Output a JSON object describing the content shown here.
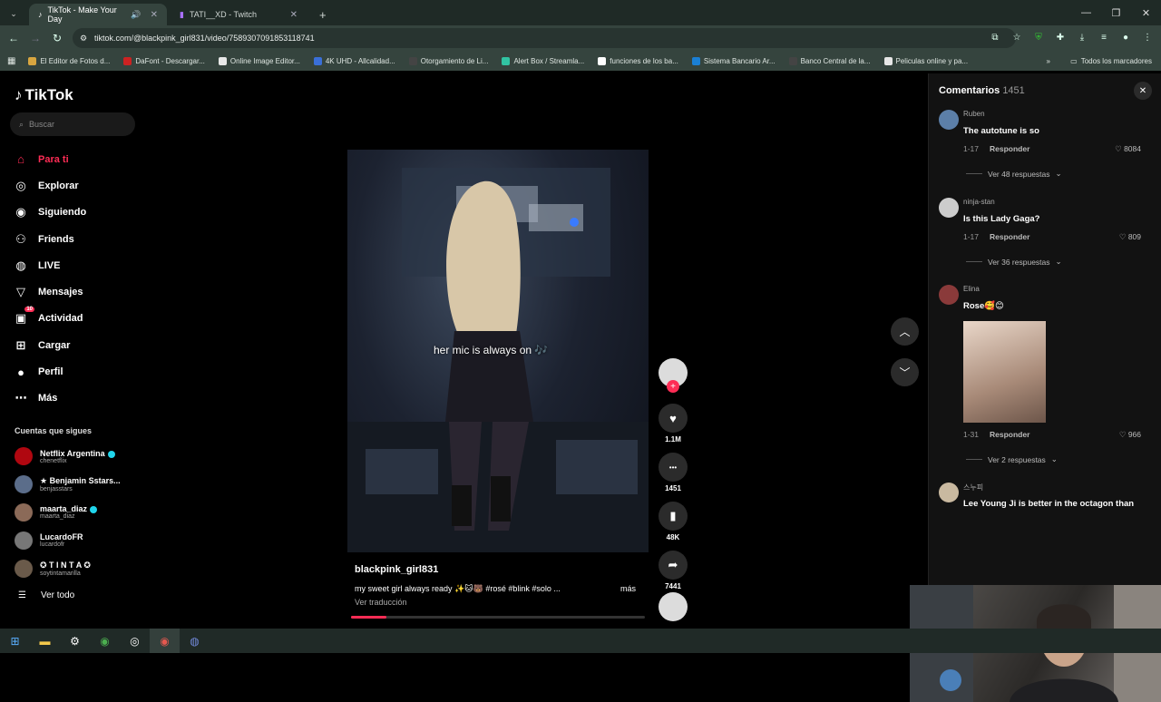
{
  "browser": {
    "tabs": [
      {
        "label": "TikTok - Make Your Day",
        "active": true
      },
      {
        "label": "TATI__XD - Twitch",
        "active": false
      }
    ],
    "url": "tiktok.com/@blackpink_girl831/video/7589307091853118741",
    "bookmarks": [
      {
        "label": "El Editor de Fotos d...",
        "color": "#d8a640"
      },
      {
        "label": "DaFont - Descargar...",
        "color": "#cc2222"
      },
      {
        "label": "Online Image Editor...",
        "color": "#e8e8e8"
      },
      {
        "label": "4K UHD - Allcalidad...",
        "color": "#3a6fd8"
      },
      {
        "label": "Otorgamiento de Li...",
        "color": "#444444"
      },
      {
        "label": "Alert Box / Streamla...",
        "color": "#31c3a2"
      },
      {
        "label": "funciones de los ba...",
        "color": "#ffffff"
      },
      {
        "label": "Sistema Bancario Ar...",
        "color": "#1a7fd4"
      },
      {
        "label": "Banco Central de la...",
        "color": "#444444"
      },
      {
        "label": "Peliculas online y pa...",
        "color": "#e6e6e6"
      }
    ],
    "bookmarks_folder": "Todos los marcadores"
  },
  "tiktok": {
    "logo": "TikTok",
    "search_placeholder": "Buscar",
    "nav": [
      {
        "label": "Para ti",
        "icon": "home-icon",
        "active": true
      },
      {
        "label": "Explorar",
        "icon": "compass-icon"
      },
      {
        "label": "Siguiendo",
        "icon": "following-icon"
      },
      {
        "label": "Friends",
        "icon": "friends-icon"
      },
      {
        "label": "LIVE",
        "icon": "live-icon"
      },
      {
        "label": "Mensajes",
        "icon": "messages-icon"
      },
      {
        "label": "Actividad",
        "icon": "activity-icon",
        "badge": "10"
      },
      {
        "label": "Cargar",
        "icon": "upload-icon"
      },
      {
        "label": "Perfil",
        "icon": "profile-icon"
      },
      {
        "label": "Más",
        "icon": "more-icon"
      }
    ],
    "following_title": "Cuentas que sigues",
    "following": [
      {
        "name": "Netflix Argentina",
        "handle": "chenetflix",
        "verified": true,
        "color": "#b00710"
      },
      {
        "name": "★ Benjamin Sstars...",
        "handle": "benjasstars",
        "verified": false,
        "color": "#5b6d8a"
      },
      {
        "name": "maarta_diaz",
        "handle": "maarta_diaz",
        "verified": true,
        "color": "#8b6a58"
      },
      {
        "name": "LucardoFR",
        "handle": "lucardofr",
        "verified": false,
        "color": "#777777"
      },
      {
        "name": "✪ T I N T A ✪",
        "handle": "soytintamarilla",
        "verified": false,
        "color": "#6a5a4a"
      }
    ],
    "see_all": "Ver todo",
    "video": {
      "subtitle": "her mic is always on 🎶",
      "user": "blackpink_girl831",
      "description": "my sweet girl always ready ✨🐱🐻 #rosé #blink #solo ...",
      "more": "más",
      "translate": "Ver traducción",
      "progress": 0.12
    },
    "actions": [
      {
        "icon": "heart-icon",
        "count": "1.1M"
      },
      {
        "icon": "comment-icon",
        "count": "1451"
      },
      {
        "icon": "bookmark-icon",
        "count": "48K"
      },
      {
        "icon": "share-icon",
        "count": "7441"
      }
    ],
    "comments_panel": {
      "title": "Comentarios",
      "count": "1451",
      "comments": [
        {
          "user": "Ruben",
          "text": "The autotune is so",
          "date": "1-17",
          "reply": "Responder",
          "likes": "8084",
          "replies": "Ver 48 respuestas",
          "color": "#5c7fa8"
        },
        {
          "user": "ninja-stan",
          "text": "Is this Lady Gaga?",
          "date": "1-17",
          "reply": "Responder",
          "likes": "809",
          "replies": "Ver 36 respuestas",
          "color": "#cccccc"
        },
        {
          "user": "Elina",
          "text": "Rose🥰😊",
          "date": "1-31",
          "reply": "Responder",
          "likes": "966",
          "replies": "Ver 2 respuestas",
          "color": "#8a3a3a"
        },
        {
          "user": "스누피",
          "text": "Lee Young Ji is better in the octagon than",
          "color": "#c9b9a0"
        }
      ]
    }
  }
}
